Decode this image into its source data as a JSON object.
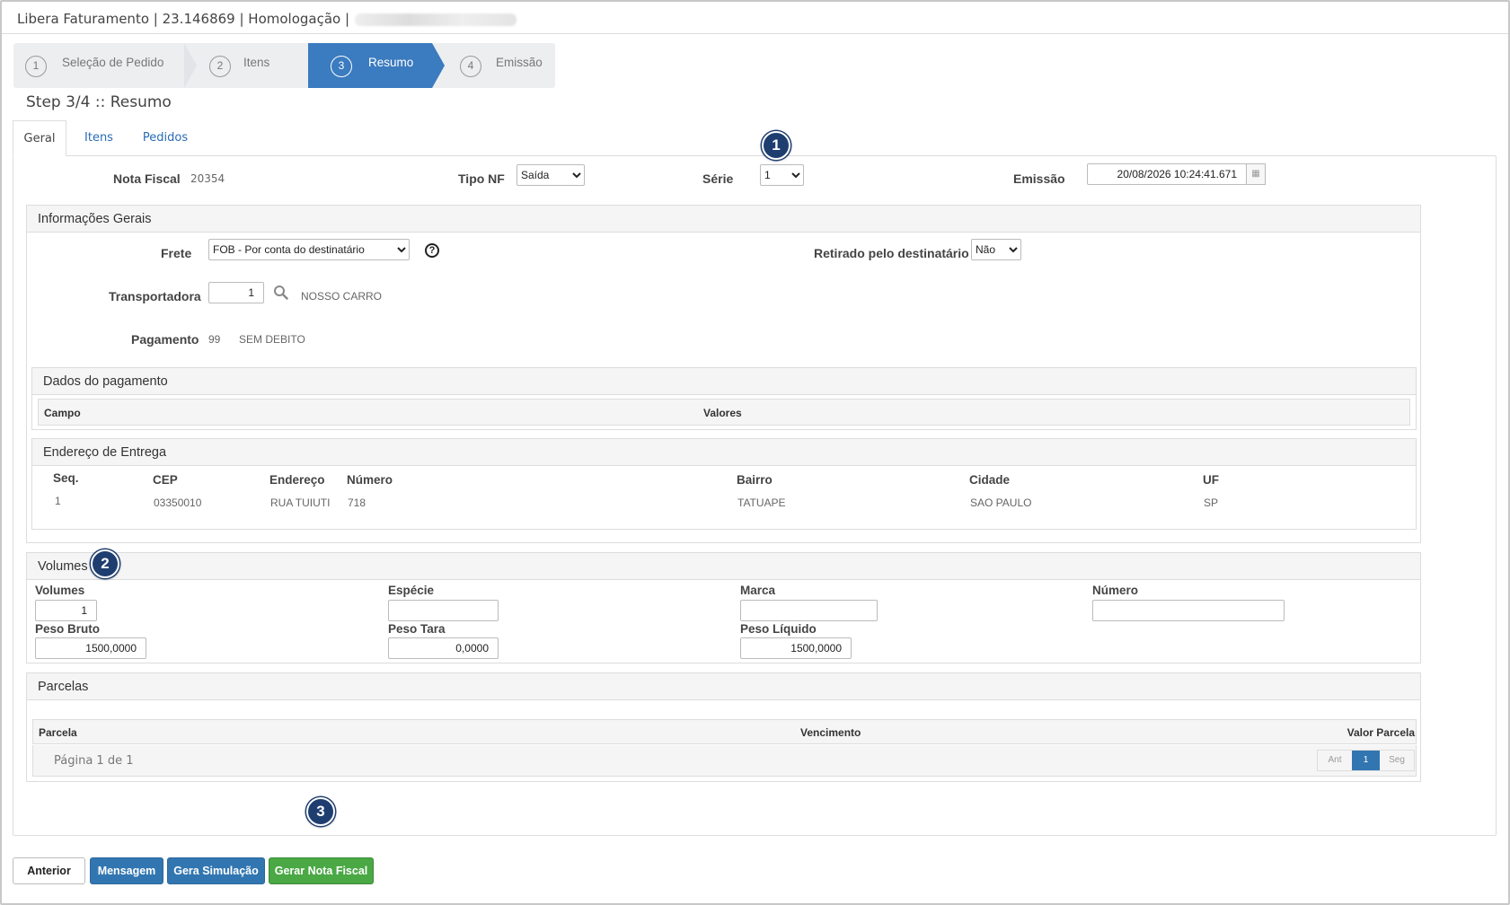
{
  "title": "Libera Faturamento | 23.146869 | Homologação |",
  "wizard": {
    "steps": [
      {
        "num": "1",
        "label": "Seleção de Pedido"
      },
      {
        "num": "2",
        "label": "Itens"
      },
      {
        "num": "3",
        "label": "Resumo"
      },
      {
        "num": "4",
        "label": "Emissão"
      }
    ]
  },
  "step_title": "Step 3/4 :: Resumo",
  "tabs": [
    "Geral",
    "Itens",
    "Pedidos"
  ],
  "header": {
    "nota_fiscal_label": "Nota Fiscal",
    "nota_fiscal_value": "20354",
    "tipo_nf_label": "Tipo NF",
    "tipo_nf_value": "Saída",
    "serie_label": "Série",
    "serie_value": "1",
    "emissao_label": "Emissão",
    "emissao_value": "20/08/2026 10:24:41.671"
  },
  "info": {
    "title": "Informações Gerais",
    "frete_label": "Frete",
    "frete_value": "FOB - Por conta do destinatário",
    "retirado_label": "Retirado pelo destinatário",
    "retirado_value": "Não",
    "transportadora_label": "Transportadora",
    "transportadora_value": "1",
    "transportadora_name": "NOSSO CARRO",
    "pagamento_label": "Pagamento",
    "pagamento_code": "99",
    "pagamento_desc": "SEM DEBITO"
  },
  "dados_pagamento": {
    "title": "Dados do pagamento",
    "col_campo": "Campo",
    "col_valores": "Valores"
  },
  "endereco": {
    "title": "Endereço de Entrega",
    "headers": [
      "Seq.",
      "CEP",
      "Endereço",
      "Número",
      "Bairro",
      "Cidade",
      "UF"
    ],
    "row": [
      "1",
      "03350010",
      "RUA TUIUTI",
      "718",
      "TATUAPE",
      "SAO PAULO",
      "SP"
    ]
  },
  "volumes": {
    "title": "Volumes",
    "volumes_label": "Volumes",
    "volumes_value": "1",
    "especie_label": "Espécie",
    "marca_label": "Marca",
    "numero_label": "Número",
    "peso_bruto_label": "Peso Bruto",
    "peso_bruto_value": "1500,0000",
    "peso_tara_label": "Peso Tara",
    "peso_tara_value": "0,0000",
    "peso_liquido_label": "Peso Líquido",
    "peso_liquido_value": "1500,0000"
  },
  "parcelas": {
    "title": "Parcelas",
    "col_parcela": "Parcela",
    "col_vencimento": "Vencimento",
    "col_valor": "Valor Parcela",
    "pagina": "Página 1 de 1",
    "pager_prev": "Ant",
    "pager_cur": "1",
    "pager_next": "Seg"
  },
  "badges": [
    "1",
    "2",
    "3"
  ],
  "buttons": {
    "anterior": "Anterior",
    "mensagem": "Mensagem",
    "simulacao": "Gera Simulação",
    "gerar": "Gerar Nota Fiscal"
  },
  "colors": {
    "primary": "#3276b1",
    "success": "#4aa845",
    "badge": "#1f3e70",
    "wizard_active": "#3b7bbf"
  }
}
